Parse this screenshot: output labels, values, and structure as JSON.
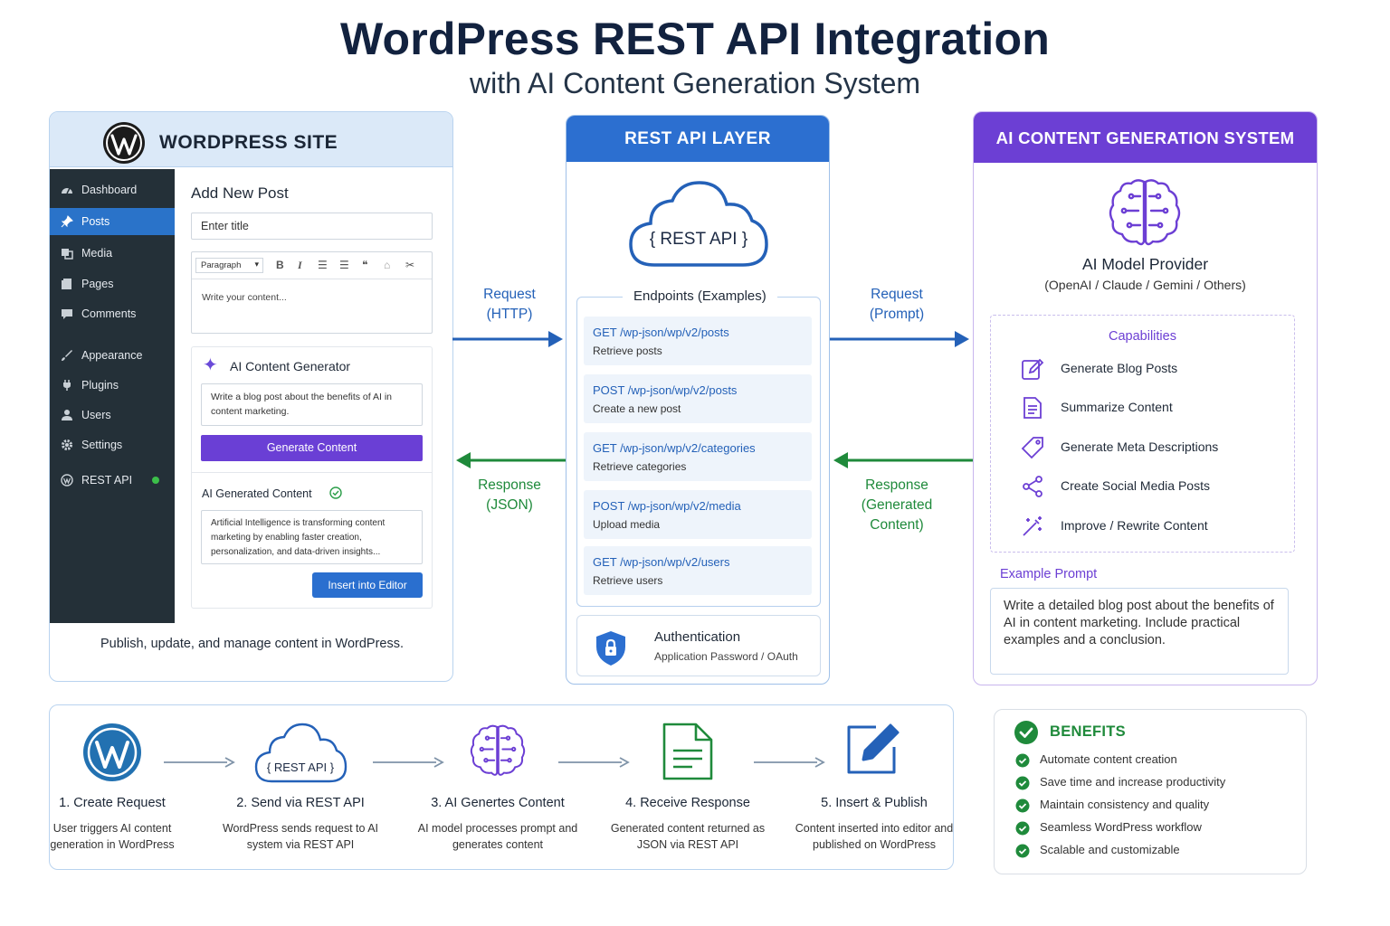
{
  "header": {
    "title": "WordPress REST API Integration",
    "subtitle": "with AI Content Generation System"
  },
  "wordpress": {
    "panel_title": "WORDPRESS SITE",
    "sidebar": [
      {
        "label": "Dashboard",
        "icon": "dashboard-icon"
      },
      {
        "label": "Posts",
        "icon": "pin-icon",
        "active": true
      },
      {
        "label": "Media",
        "icon": "media-icon"
      },
      {
        "label": "Pages",
        "icon": "pages-icon"
      },
      {
        "label": "Comments",
        "icon": "comments-icon"
      },
      {
        "label": "Appearance",
        "icon": "brush-icon"
      },
      {
        "label": "Plugins",
        "icon": "plugin-icon"
      },
      {
        "label": "Users",
        "icon": "user-icon"
      },
      {
        "label": "Settings",
        "icon": "settings-icon"
      },
      {
        "label": "REST API",
        "icon": "wordpress-icon"
      }
    ],
    "editor": {
      "heading": "Add New Post",
      "title_placeholder": "Enter title",
      "paragraph_select": "Paragraph",
      "content_placeholder": "Write your content..."
    },
    "ai_generator": {
      "title": "AI Content Generator",
      "prompt": "Write a blog post about the benefits of AI in content marketing.",
      "generate_label": "Generate Content",
      "output_title": "AI Generated Content",
      "output_text": "Artificial Intelligence is transforming content marketing by enabling faster creation, personalization, and data-driven insights...",
      "insert_label": "Insert into Editor"
    },
    "footer": "Publish, update, and manage content in WordPress."
  },
  "arrows": {
    "left_request": "Request\n(HTTP)",
    "left_response": "Response\n(JSON)",
    "right_request": "Request\n(Prompt)",
    "right_response": "Response\n(Generated\nContent)"
  },
  "rest": {
    "panel_title": "REST API LAYER",
    "cloud_label": "{ REST API }",
    "endpoints_title": "Endpoints (Examples)",
    "endpoints": [
      {
        "method_path": "GET  /wp-json/wp/v2/posts",
        "desc": "Retrieve posts"
      },
      {
        "method_path": "POST  /wp-json/wp/v2/posts",
        "desc": "Create a new post"
      },
      {
        "method_path": "GET  /wp-json/wp/v2/categories",
        "desc": "Retrieve categories"
      },
      {
        "method_path": "POST  /wp-json/wp/v2/media",
        "desc": "Upload media"
      },
      {
        "method_path": "GET  /wp-json/wp/v2/users",
        "desc": "Retrieve users"
      }
    ],
    "auth_title": "Authentication",
    "auth_sub": "Application Password / OAuth"
  },
  "ai": {
    "panel_title": "AI CONTENT GENERATION SYSTEM",
    "provider_title": "AI Model Provider",
    "provider_sub": "(OpenAI / Claude / Gemini / Others)",
    "capabilities_title": "Capabilities",
    "capabilities": [
      {
        "label": "Generate Blog Posts",
        "icon": "edit-icon"
      },
      {
        "label": "Summarize Content",
        "icon": "document-icon"
      },
      {
        "label": "Generate Meta Descriptions",
        "icon": "tag-icon"
      },
      {
        "label": "Create Social Media Posts",
        "icon": "share-icon"
      },
      {
        "label": "Improve / Rewrite Content",
        "icon": "magic-wand-icon"
      }
    ],
    "example_title": "Example Prompt",
    "example_text": "Write a detailed blog post about the benefits of AI in content marketing. Include practical examples and a conclusion."
  },
  "steps": [
    {
      "title": "1. Create Request",
      "desc": "User triggers AI content generation in WordPress",
      "icon": "wordpress-icon"
    },
    {
      "title": "2. Send via REST API",
      "desc": "WordPress sends request to AI system via REST API",
      "icon": "cloud-icon"
    },
    {
      "title": "3. AI Genertes Content",
      "desc": "AI model processes prompt and generates content",
      "icon": "brain-icon"
    },
    {
      "title": "4. Receive Response",
      "desc": "Generated content returned as JSON via REST API",
      "icon": "document-icon"
    },
    {
      "title": "5. Insert & Publish",
      "desc": "Content inserted into editor and published on WordPress",
      "icon": "edit-icon"
    }
  ],
  "step_cloud_label": "{ REST API }",
  "benefits": {
    "title": "BENEFITS",
    "items": [
      "Automate content creation",
      "Save time and increase productivity",
      "Maintain consistency and quality",
      "Seamless WordPress workflow",
      "Scalable and customizable"
    ]
  },
  "colors": {
    "navy": "#12223f",
    "blue": "#2c6fd0",
    "purple": "#6c3fd4",
    "green": "#1f8a3b",
    "sidebar": "#243038"
  }
}
